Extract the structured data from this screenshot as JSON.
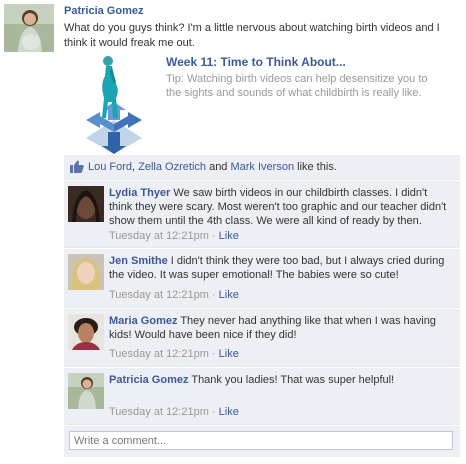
{
  "post": {
    "author": "Patricia Gomez",
    "text": "What do you guys think? I'm a little nervous about watching birth videos and I think it would freak me out.",
    "attachment": {
      "title": "Week 11: Time to Think About...",
      "tip": "Tip:  Watching birth videos can help desensitize you to the sights and sounds of what childbirth is really like."
    }
  },
  "likes": {
    "names": [
      "Lou Ford",
      "Zella Ozretich",
      "Mark Iverson"
    ],
    "sep1": ", ",
    "sep2": " and ",
    "suffix": " like this."
  },
  "comments": [
    {
      "author": "Lydia Thyer",
      "text": "We saw birth videos in our childbirth classes.  I didn't think they were scary.  Most weren't too graphic and our teacher didn't show them until the 4th class.  We were all kind of ready by then.",
      "time": "Tuesday at 12:21pm",
      "dot": " · ",
      "like": "Like"
    },
    {
      "author": "Jen Smithe",
      "text": "I didn't think they were too bad, but I always cried during the video.  It was super emotional!  The babies were so cute!",
      "time": "Tuesday at 12:21pm",
      "dot": " · ",
      "like": "Like"
    },
    {
      "author": "Maria Gomez",
      "text": "They never had anything like that when I was having kids!  Would have been nice if they did!",
      "time": "Tuesday at 12:21pm",
      "dot": " · ",
      "like": "Like"
    },
    {
      "author": "Patricia Gomez",
      "text": "Thank you ladies!  That was super helpful!",
      "time": "Tuesday at 12:21pm",
      "dot": " · ",
      "like": "Like"
    }
  ],
  "composer": {
    "placeholder": "Write a comment..."
  },
  "colors": {
    "link": "#3b5998",
    "panel": "#edeff4",
    "meta": "#999999"
  },
  "icons": [
    "thumbs-up-icon"
  ]
}
